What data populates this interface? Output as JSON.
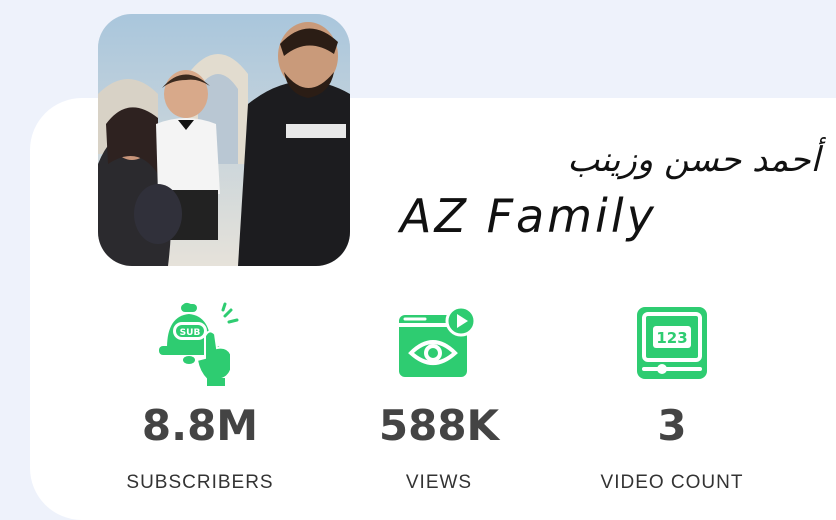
{
  "channel": {
    "name_arabic": "أحمد حسن وزينب",
    "name_latin": "AZ Family",
    "avatar_icon": "family-photo-avatar"
  },
  "stats": [
    {
      "value": "8.8M",
      "label": "SUBSCRIBERS",
      "icon": "subscribe-bell-icon"
    },
    {
      "value": "588K",
      "label": "VIEWS",
      "icon": "video-views-icon"
    },
    {
      "value": "3",
      "label": "VIDEO COUNT",
      "icon": "video-count-icon"
    }
  ],
  "colors": {
    "accent": "#2ecc71",
    "background": "#eef2fb",
    "card": "#ffffff",
    "value_text": "#444444"
  }
}
